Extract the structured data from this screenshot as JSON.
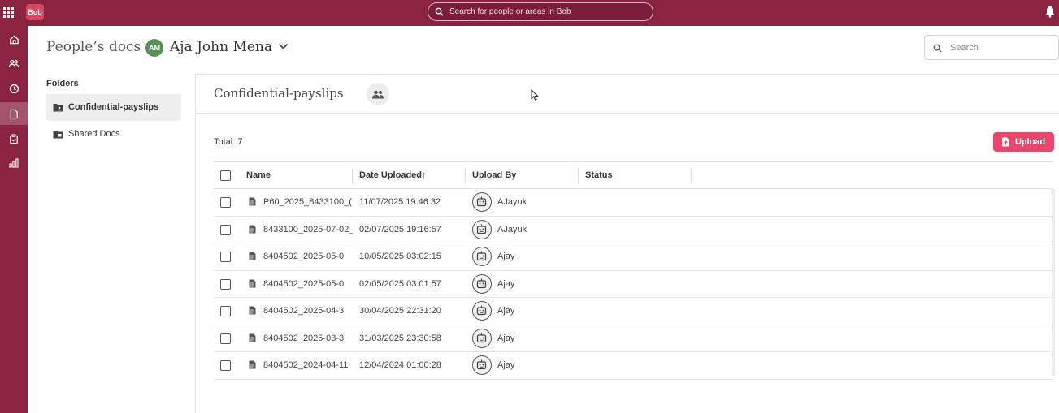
{
  "topbar": {
    "logo_text": "Bob",
    "search_placeholder": "Search for people or areas in Bob",
    "bg_color": "#8a2340"
  },
  "rail": {
    "items": [
      {
        "icon": "home-icon",
        "active": false
      },
      {
        "icon": "people-icon",
        "active": false
      },
      {
        "icon": "clock-icon",
        "active": false
      },
      {
        "icon": "document-icon",
        "active": true
      },
      {
        "icon": "clipboard-icon",
        "active": false
      },
      {
        "icon": "analytics-icon",
        "active": false
      }
    ]
  },
  "header": {
    "title": "People’s docs",
    "avatar_initials": "AM",
    "person_name": "Aja John Mena",
    "search_placeholder": "Search"
  },
  "folders": {
    "label": "Folders",
    "items": [
      {
        "label": "Confidential-payslips",
        "active": true
      },
      {
        "label": "Shared Docs",
        "active": false
      }
    ]
  },
  "main": {
    "folder_title": "Confidential-payslips",
    "total": "Total: 7",
    "upload_label": "Upload",
    "accent_color": "#e8466a"
  },
  "table": {
    "columns": [
      "Name",
      "Date Uploaded",
      "Upload By",
      "Status"
    ],
    "sort_indicator": "↑",
    "rows": [
      {
        "name": "P60_2025_8433100_(",
        "date": "11/07/2025 19:46:32",
        "by": "AJayuk",
        "status": ""
      },
      {
        "name": "8433100_2025-07-02_",
        "date": "02/07/2025 19:16:57",
        "by": "AJayuk",
        "status": ""
      },
      {
        "name": "8404502_2025-05-0",
        "date": "10/05/2025 03:02:15",
        "by": "Ajay",
        "status": ""
      },
      {
        "name": "8404502_2025-05-0",
        "date": "02/05/2025 03:01:57",
        "by": "Ajay",
        "status": ""
      },
      {
        "name": "8404502_2025-04-3",
        "date": "30/04/2025 22:31:20",
        "by": "Ajay",
        "status": ""
      },
      {
        "name": "8404502_2025-03-3",
        "date": "31/03/2025 23:30:58",
        "by": "Ajay",
        "status": ""
      },
      {
        "name": "8404502_2024-04-11",
        "date": "12/04/2024 01:00:28",
        "by": "Ajay",
        "status": ""
      }
    ]
  }
}
